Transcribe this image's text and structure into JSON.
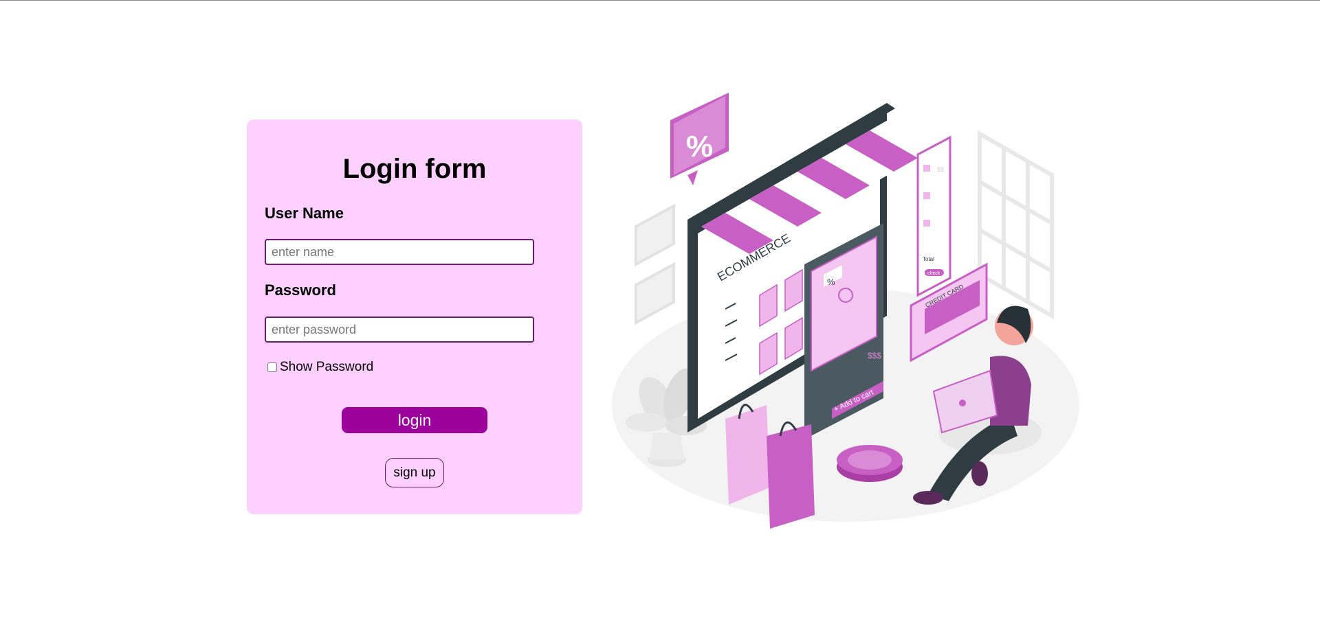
{
  "form": {
    "title": "Login form",
    "username_label": "User Name",
    "username_placeholder": "enter name",
    "password_label": "Password",
    "password_placeholder": "enter password",
    "show_password_label": "Show Password",
    "login_button": "login",
    "signup_button": "sign up"
  },
  "illustration": {
    "sign_text": "ECOMMERCE",
    "percent_badge": "%",
    "card_percent": "%",
    "price_tag": "$$$",
    "add_to_cart": "+ Add to cart",
    "credit_card": "CREDIT CARD",
    "cart_total": "Total",
    "cart_button": "check",
    "price_item": "$$"
  },
  "colors": {
    "card_bg": "#fdd0ff",
    "accent": "#9c019c",
    "illustration_pink": "#c85fc4",
    "illustration_dark": "#2f3c42"
  }
}
